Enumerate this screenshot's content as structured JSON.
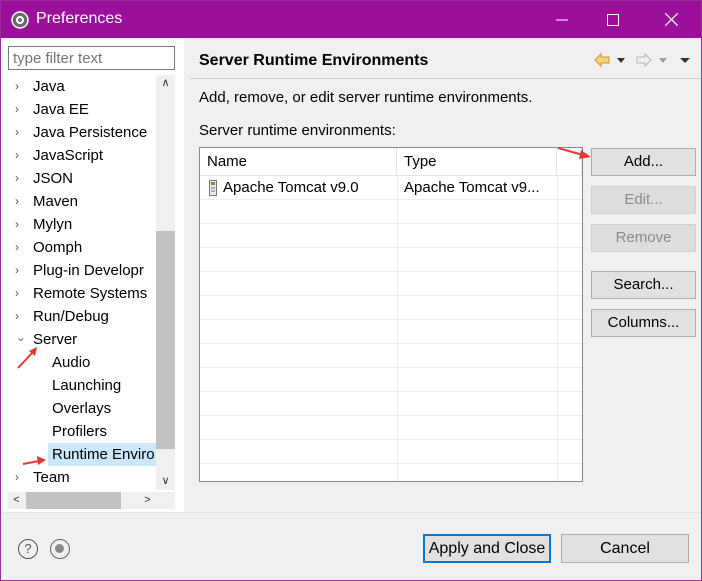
{
  "window": {
    "title": "Preferences",
    "accent_color": "#9b0f9b",
    "icons": {
      "app": "gear-icon",
      "minimize": "minimize-icon",
      "maximize": "maximize-icon",
      "close": "close-icon"
    }
  },
  "filter": {
    "placeholder": "type filter text"
  },
  "tree": {
    "items": [
      {
        "label": "Java",
        "expanded": false
      },
      {
        "label": "Java EE",
        "expanded": false
      },
      {
        "label": "Java Persistence",
        "expanded": false
      },
      {
        "label": "JavaScript",
        "expanded": false
      },
      {
        "label": "JSON",
        "expanded": false
      },
      {
        "label": "Maven",
        "expanded": false
      },
      {
        "label": "Mylyn",
        "expanded": false
      },
      {
        "label": "Oomph",
        "expanded": false
      },
      {
        "label": "Plug-in Developr",
        "expanded": false
      },
      {
        "label": "Remote Systems",
        "expanded": false
      },
      {
        "label": "Run/Debug",
        "expanded": false
      },
      {
        "label": "Server",
        "expanded": true
      },
      {
        "label": "Audio",
        "child": true
      },
      {
        "label": "Launching",
        "child": true
      },
      {
        "label": "Overlays",
        "child": true
      },
      {
        "label": "Profilers",
        "child": true
      },
      {
        "label": "Runtime Enviro",
        "child": true,
        "selected": true
      },
      {
        "label": "Team",
        "expanded": false
      }
    ]
  },
  "page": {
    "title": "Server Runtime Environments",
    "description": "Add, remove, or edit server runtime environments.",
    "list_label": "Server runtime environments:",
    "nav_icons": [
      "back-arrow-icon",
      "back-menu-icon",
      "forward-arrow-icon",
      "forward-menu-icon",
      "view-menu-icon"
    ]
  },
  "table": {
    "columns": [
      "Name",
      "Type"
    ],
    "rows": [
      {
        "name": "Apache Tomcat v9.0",
        "type": "Apache Tomcat v9...",
        "icon": "tomcat-server-icon"
      }
    ]
  },
  "buttons": {
    "add": "Add...",
    "edit": "Edit...",
    "remove": "Remove",
    "search": "Search...",
    "columns": "Columns..."
  },
  "footer": {
    "apply_close": "Apply and Close",
    "cancel": "Cancel",
    "help_icon": "help-icon",
    "record_icon": "record-icon"
  },
  "annotations": {
    "arrow_color": "#e53935"
  }
}
